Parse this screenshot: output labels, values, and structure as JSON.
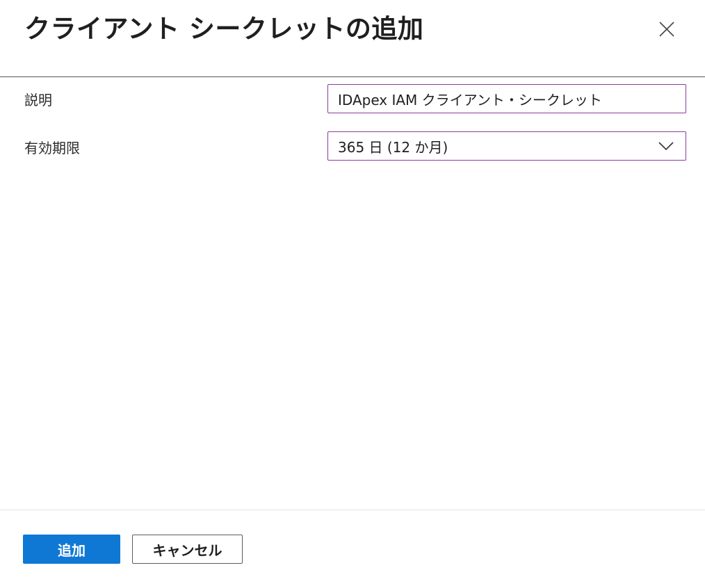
{
  "panel": {
    "title": "クライアント シークレットの追加"
  },
  "form": {
    "description_label": "説明",
    "description_value": "IDApex IAM クライアント・シークレット",
    "expiry_label": "有効期限",
    "expiry_selected": "365 日 (12 か月)"
  },
  "footer": {
    "add_label": "追加",
    "cancel_label": "キャンセル"
  },
  "icons": {
    "close": "close-icon",
    "dropdown": "chevron-down-icon"
  },
  "colors": {
    "primary": "#0f78d4",
    "input_border": "#8a3a9c"
  }
}
